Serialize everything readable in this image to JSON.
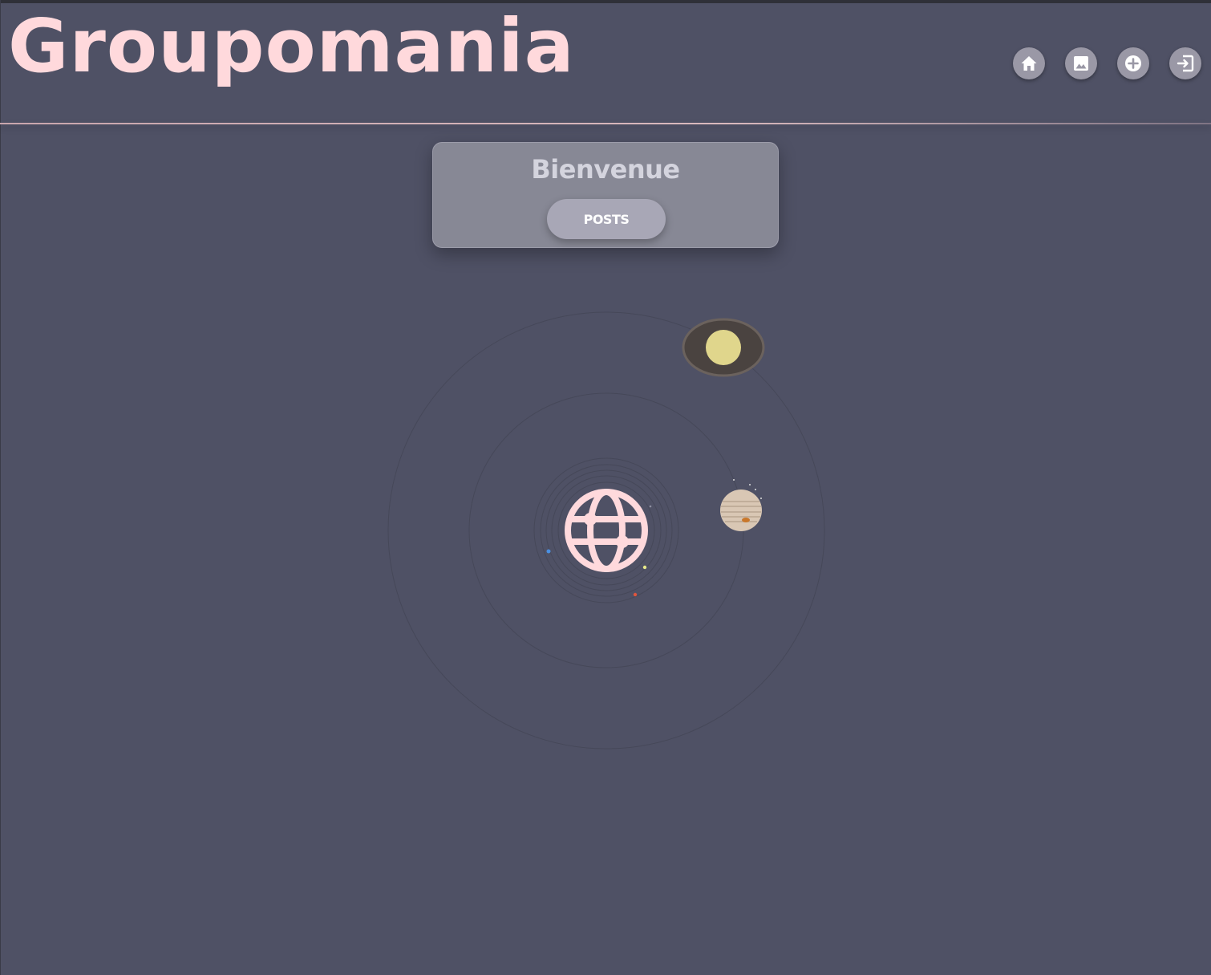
{
  "header": {
    "logo_text": "Groupomania",
    "nav": [
      {
        "icon": "home-icon"
      },
      {
        "icon": "image-icon"
      },
      {
        "icon": "plus-circle-icon"
      },
      {
        "icon": "logout-icon"
      }
    ]
  },
  "welcome": {
    "title": "Bienvenue",
    "button_label": "POSTS"
  },
  "colors": {
    "background": "#4f5165",
    "logo": "#ffd9dc",
    "card": "#878895",
    "button": "#a8a7b6",
    "nav_button": "#9a98a6"
  }
}
